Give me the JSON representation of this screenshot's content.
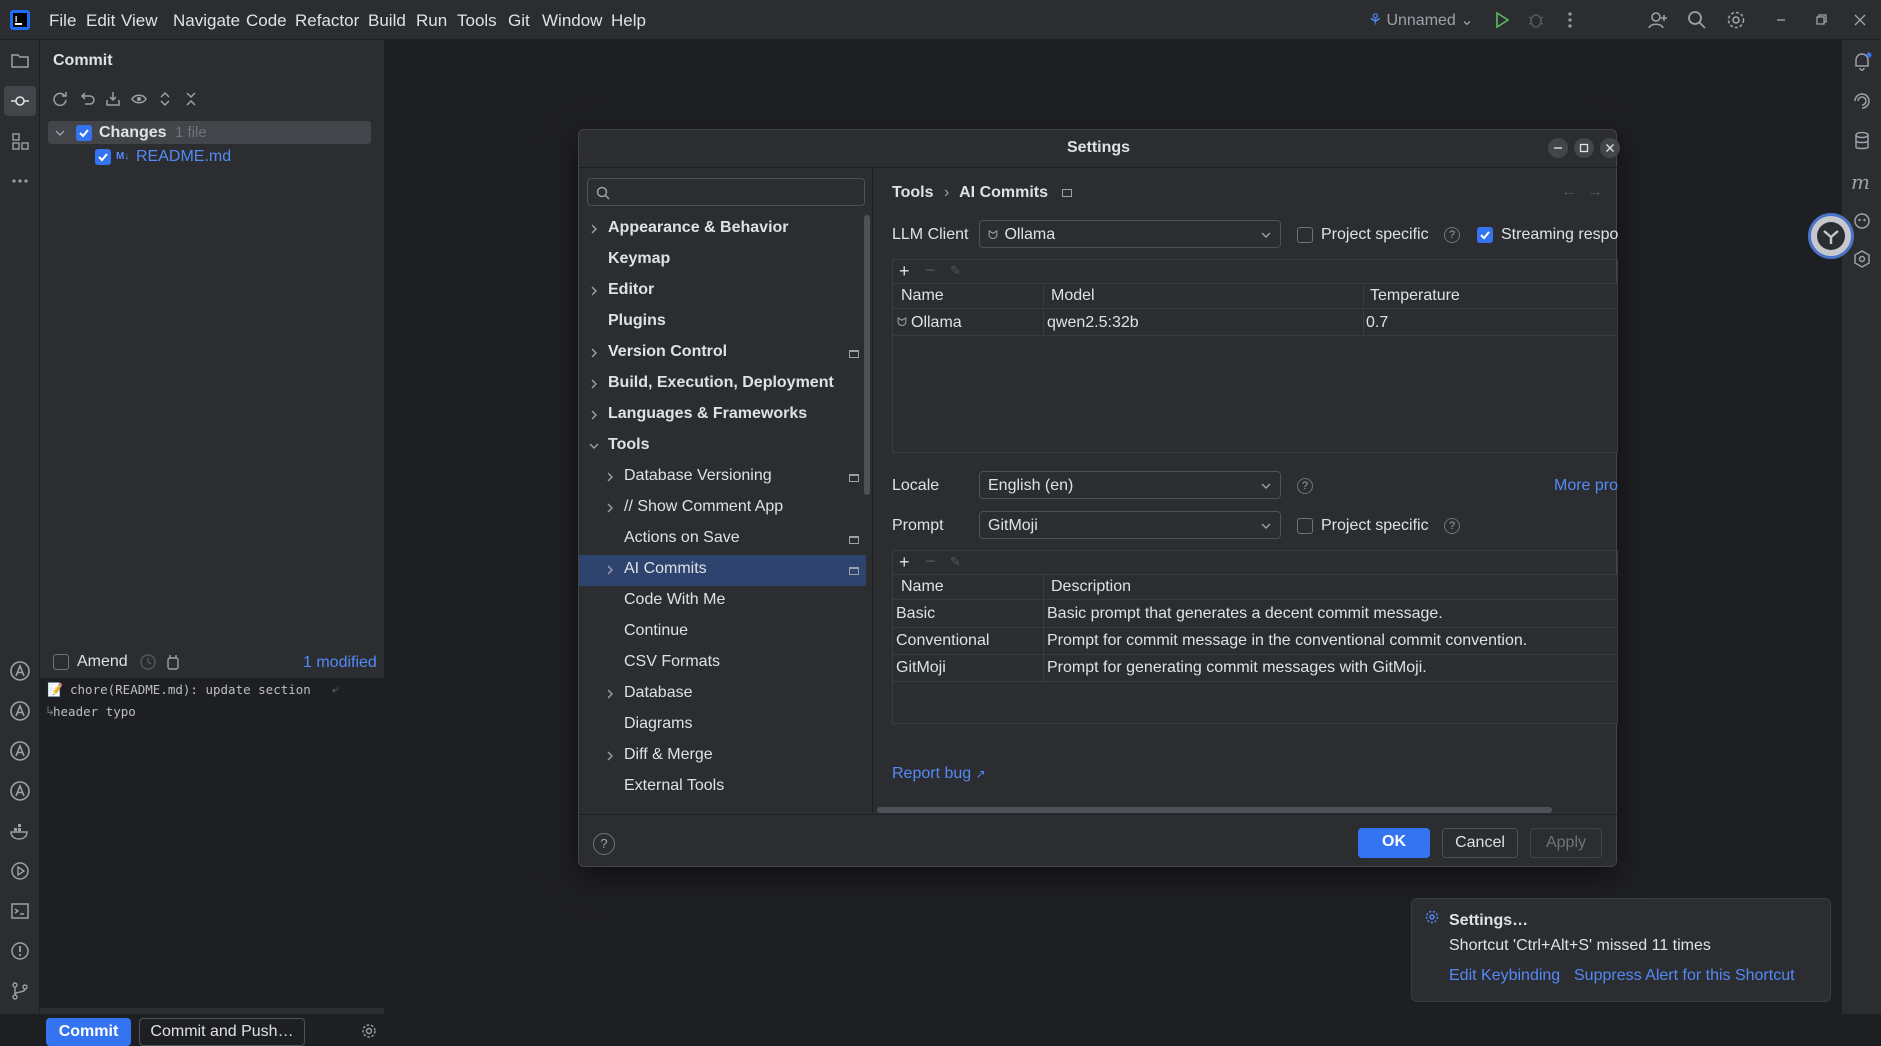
{
  "menu": [
    "File",
    "Edit",
    "View",
    "Navigate",
    "Code",
    "Refactor",
    "Build",
    "Run",
    "Tools",
    "Git",
    "Window",
    "Help"
  ],
  "run_config": "Unnamed",
  "commit_panel": {
    "title": "Commit",
    "changes_label": "Changes",
    "changes_count": "1 file",
    "file_name": "README.md",
    "file_type_badge": "M↓",
    "amend_label": "Amend",
    "modified_label": "1 modified",
    "message_line1": "chore(README.md): update section",
    "message_line2": "header typo",
    "commit_button": "Commit",
    "commit_push_button": "Commit and Push…"
  },
  "dialog": {
    "title": "Settings",
    "search_placeholder": "",
    "tree": [
      {
        "label": "Appearance & Behavior",
        "bold": true,
        "chevron": "right",
        "indent": 0
      },
      {
        "label": "Keymap",
        "bold": true,
        "chevron": "",
        "indent": 0
      },
      {
        "label": "Editor",
        "bold": true,
        "chevron": "right",
        "indent": 0
      },
      {
        "label": "Plugins",
        "bold": true,
        "chevron": "",
        "indent": 0
      },
      {
        "label": "Version Control",
        "bold": true,
        "chevron": "right",
        "indent": 0,
        "pin": true
      },
      {
        "label": "Build, Execution, Deployment",
        "bold": true,
        "chevron": "right",
        "indent": 0
      },
      {
        "label": "Languages & Frameworks",
        "bold": true,
        "chevron": "right",
        "indent": 0
      },
      {
        "label": "Tools",
        "bold": true,
        "chevron": "down",
        "indent": 0
      },
      {
        "label": "Database Versioning",
        "bold": false,
        "chevron": "right",
        "indent": 1,
        "pin": true
      },
      {
        "label": "// Show Comment App",
        "bold": false,
        "chevron": "right",
        "indent": 1
      },
      {
        "label": "Actions on Save",
        "bold": false,
        "chevron": "",
        "indent": 1,
        "pin": true
      },
      {
        "label": "AI Commits",
        "bold": false,
        "chevron": "right",
        "indent": 1,
        "pin": true,
        "selected": true
      },
      {
        "label": "Code With Me",
        "bold": false,
        "chevron": "",
        "indent": 1
      },
      {
        "label": "Continue",
        "bold": false,
        "chevron": "",
        "indent": 1
      },
      {
        "label": "CSV Formats",
        "bold": false,
        "chevron": "",
        "indent": 1
      },
      {
        "label": "Database",
        "bold": false,
        "chevron": "right",
        "indent": 1
      },
      {
        "label": "Diagrams",
        "bold": false,
        "chevron": "",
        "indent": 1
      },
      {
        "label": "Diff & Merge",
        "bold": false,
        "chevron": "right",
        "indent": 1
      },
      {
        "label": "External Tools",
        "bold": false,
        "chevron": "",
        "indent": 1
      }
    ],
    "breadcrumb_parent": "Tools",
    "breadcrumb_current": "AI Commits",
    "llm_client_label": "LLM Client",
    "llm_client_value": "Ollama",
    "project_specific_label": "Project specific",
    "streaming_label": "Streaming respo",
    "llm_table": {
      "headers": [
        "Name",
        "Model",
        "Temperature"
      ],
      "rows": [
        [
          "Ollama",
          "qwen2.5:32b",
          "0.7"
        ]
      ]
    },
    "locale_label": "Locale",
    "locale_value": "English (en)",
    "more_link": "More pro",
    "prompt_label": "Prompt",
    "prompt_value": "GitMoji",
    "prompt_project_specific": "Project specific",
    "prompt_table": {
      "headers": [
        "Name",
        "Description"
      ],
      "rows": [
        [
          "Basic",
          "Basic prompt that generates a decent commit message."
        ],
        [
          "Conventional",
          "Prompt for commit message in the conventional commit convention."
        ],
        [
          "GitMoji",
          "Prompt for generating commit messages with GitMoji."
        ]
      ]
    },
    "report_bug": "Report bug",
    "ok": "OK",
    "cancel": "Cancel",
    "apply": "Apply"
  },
  "notification": {
    "title": "Settings…",
    "body": "Shortcut 'Ctrl+Alt+S' missed 11 times",
    "action1": "Edit Keybinding",
    "action2": "Suppress Alert for this Shortcut"
  },
  "colors": {
    "accent": "#3574f0",
    "link": "#548af7",
    "background": "#1e1f22",
    "panel": "#2b2d30"
  }
}
